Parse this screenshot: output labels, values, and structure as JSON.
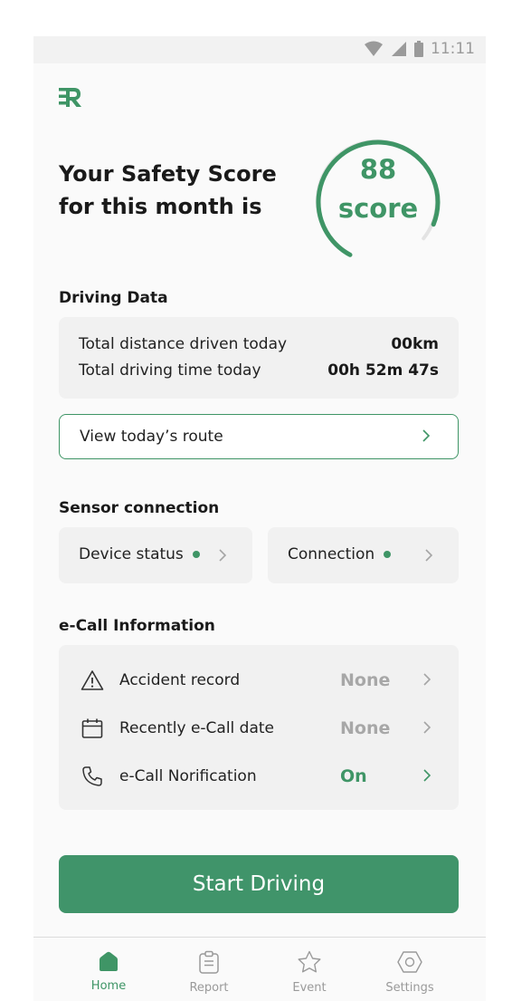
{
  "status_bar": {
    "time": "11:11",
    "icons": [
      "wifi-icon",
      "cell-signal-icon",
      "battery-icon"
    ]
  },
  "brand": {
    "logo_icon": "r-logo-icon",
    "accent_color": "#3f9566"
  },
  "safety_score": {
    "headline_line1": "Your Safety Score",
    "headline_line2": "for this month is",
    "value": "88",
    "unit": "score",
    "ring_fraction": 0.88
  },
  "driving_data": {
    "title": "Driving Data",
    "distance_label": "Total distance driven today",
    "distance_value": "00km",
    "time_label": "Total driving time today",
    "time_value": "00h 52m 47s",
    "route_button": "View today’s route"
  },
  "sensor": {
    "title": "Sensor connection",
    "device_status": "Device status",
    "connection": "Connection",
    "status_color": "#3f9566"
  },
  "ecall": {
    "title": "e-Call Information",
    "rows": [
      {
        "icon": "warning-icon",
        "label": "Accident record",
        "value": "None"
      },
      {
        "icon": "calendar-icon",
        "label": "Recently e-Call date",
        "value": "None"
      },
      {
        "icon": "phone-icon",
        "label": "e-Call Norification",
        "value": "On"
      }
    ]
  },
  "start_button": "Start Driving",
  "tabs": [
    {
      "label": "Home",
      "icon": "home-icon",
      "active": true
    },
    {
      "label": "Report",
      "icon": "clipboard-icon",
      "active": false
    },
    {
      "label": "Event",
      "icon": "star-icon",
      "active": false
    },
    {
      "label": "Settings",
      "icon": "settings-icon",
      "active": false
    }
  ]
}
